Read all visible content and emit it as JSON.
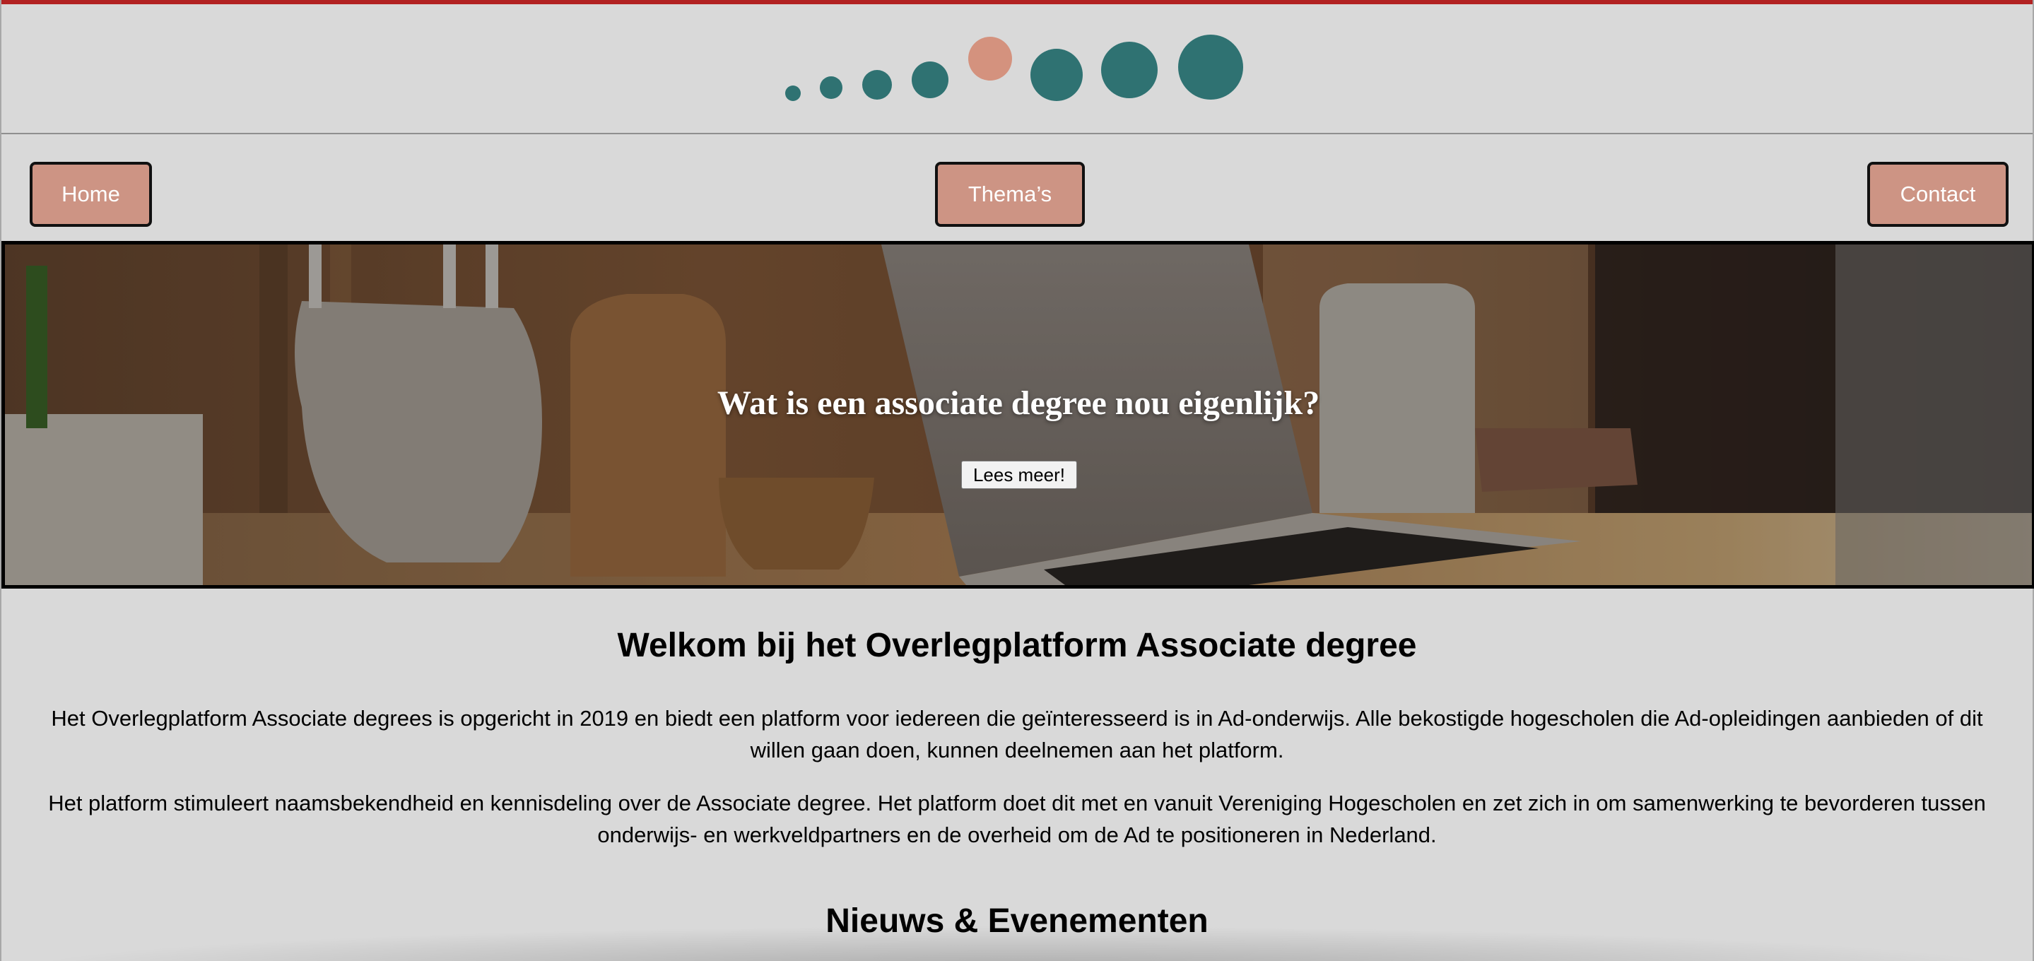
{
  "colors": {
    "accent_stripe": "#b22222",
    "logo_teal": "#2f7272",
    "logo_salmon": "#d4927e",
    "nav_button_bg": "#cd9484",
    "page_bg": "#d9d9d9"
  },
  "logo": {
    "icon": "dots-logo-icon"
  },
  "nav": {
    "home_label": "Home",
    "themes_label": "Thema’s",
    "contact_label": "Contact"
  },
  "hero": {
    "title": "Wat is een associate degree nou eigenlijk?",
    "button_label": "Lees meer!"
  },
  "main": {
    "welcome_title": "Welkom bij het Overlegplatform Associate degree",
    "paragraph_1": "Het Overlegplatform Associate degrees is opgericht in 2019 en biedt een platform voor iedereen die geïnteresseerd is in Ad-onderwijs. Alle bekostigde hogescholen die Ad-opleidingen aanbieden of dit willen gaan doen, kunnen deelnemen aan het platform.",
    "paragraph_2": "Het platform stimuleert naamsbekendheid en kennisdeling over de Associate degree. Het platform doet dit met en vanuit Vereniging Hogescholen en zet zich in om samenwerking te bevorderen tussen onderwijs- en werkveldpartners en de overheid om de Ad te positioneren in Nederland.",
    "news_title": "Nieuws & Evenementen"
  }
}
